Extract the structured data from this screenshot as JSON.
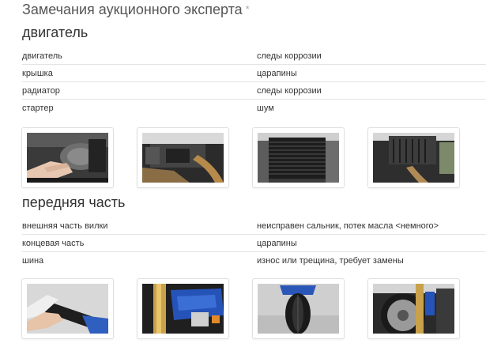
{
  "header": {
    "title": "Замечания аукционного эксперта",
    "asterisk": "*"
  },
  "sections": [
    {
      "title": "двигатель",
      "rows": [
        {
          "part": "двигатель",
          "issue": "следы коррозии"
        },
        {
          "part": "крышка",
          "issue": "царапины"
        },
        {
          "part": "радиатор",
          "issue": "следы коррозии"
        },
        {
          "part": "стартер",
          "issue": "шум"
        }
      ],
      "photos": [
        "engine-cover-hand-photo",
        "exhaust-underside-photo",
        "radiator-photo",
        "engine-block-photo"
      ]
    },
    {
      "title": "передняя часть",
      "rows": [
        {
          "part": "внешняя часть вилки",
          "issue": "неисправен сальник, потек масла <немного>"
        },
        {
          "part": "концевая часть",
          "issue": "царапины"
        },
        {
          "part": "шина",
          "issue": "износ или трещина, требует замены"
        }
      ],
      "photos": [
        "handlebar-end-photo",
        "fork-blue-photo",
        "front-tire-photo",
        "front-wheel-fork-photo"
      ]
    }
  ]
}
